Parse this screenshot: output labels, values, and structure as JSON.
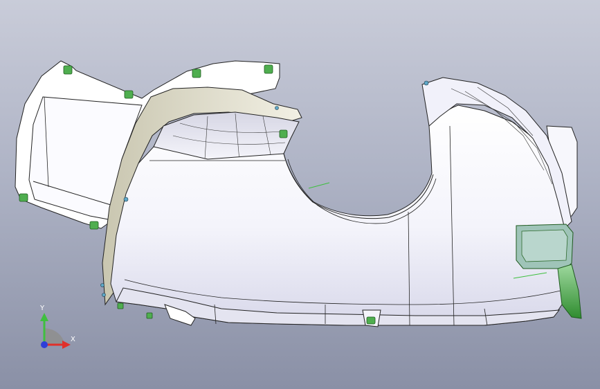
{
  "viewport": {
    "background_top": "#c9ccd9",
    "background_bottom": "#8a90a6",
    "part_color": "#ffffff",
    "part_shade": "#e6e6f2",
    "part_edge": "#1a1a1a",
    "clip_color": "#4fae4f",
    "bracket_color": "#3a9a3a",
    "flange_color": "#d9d7c8"
  },
  "triad": {
    "x_label": "X",
    "y_label": "Y",
    "x_color": "#e0302a",
    "y_color": "#3fbf3f",
    "z_color": "#2e3fd8",
    "x_icon": "x-axis-arrow-icon",
    "y_icon": "y-axis-arrow-icon",
    "origin_icon": "z-axis-origin-icon"
  }
}
